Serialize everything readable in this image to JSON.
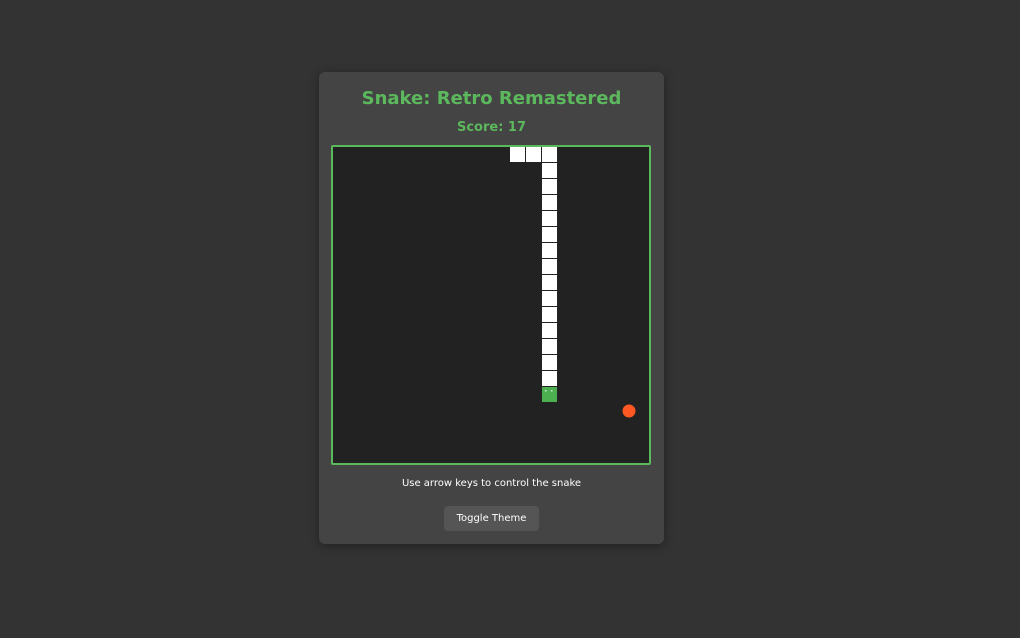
{
  "game": {
    "title": "Snake: Retro Remastered",
    "score_text": "Score: 17",
    "score": 17,
    "instructions": "Use arrow keys to control the snake",
    "toggle_label": "Toggle Theme"
  },
  "board": {
    "grid_cols": 20,
    "grid_rows": 20,
    "snake_body": [
      [
        11,
        0
      ],
      [
        12,
        0
      ],
      [
        13,
        0
      ],
      [
        13,
        1
      ],
      [
        13,
        2
      ],
      [
        13,
        3
      ],
      [
        13,
        4
      ],
      [
        13,
        5
      ],
      [
        13,
        6
      ],
      [
        13,
        7
      ],
      [
        13,
        8
      ],
      [
        13,
        9
      ],
      [
        13,
        10
      ],
      [
        13,
        11
      ],
      [
        13,
        12
      ],
      [
        13,
        13
      ],
      [
        13,
        14
      ]
    ],
    "snake_head": [
      13,
      15
    ],
    "food": [
      18,
      16
    ]
  },
  "colors": {
    "background": "#333333",
    "card": "#444444",
    "accent": "#5cb85c",
    "board": "#222222",
    "snake_body": "#ffffff",
    "snake_head": "#4caf50",
    "food": "#ff5722",
    "button": "#555555"
  }
}
